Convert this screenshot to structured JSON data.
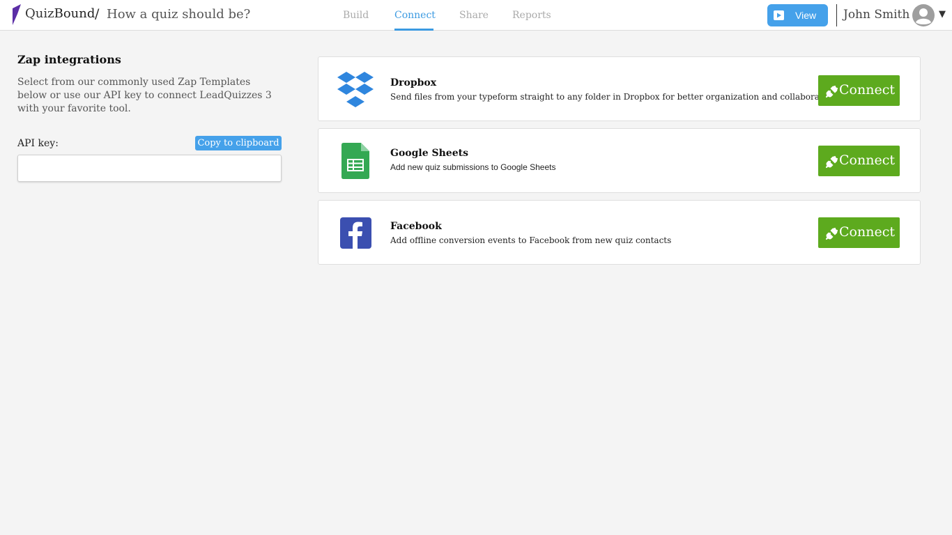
{
  "header": {
    "brand_part1": "Quiz",
    "brand_part2": "Bound",
    "separator": "/",
    "quiz_title": "How a quiz should be?",
    "tabs": [
      {
        "label": "Build",
        "active": false
      },
      {
        "label": "Connect",
        "active": true
      },
      {
        "label": "Share",
        "active": false
      },
      {
        "label": "Reports",
        "active": false
      }
    ],
    "view_button": "View",
    "username": "John Smith",
    "caret": "▼"
  },
  "left": {
    "title": "Zap integrations",
    "description": "Select from our commonly used Zap Templates below or use our API key to connect LeadQuizzes 3 with your favorite tool.",
    "api_label": "API key:",
    "copy_button": "Copy to clipboard",
    "api_value": ""
  },
  "integrations": [
    {
      "name": "Dropbox",
      "description": "Send files from your typeform straight to any folder in Dropbox for better organization and collaboration",
      "button": "Connect",
      "icon": "dropbox-icon"
    },
    {
      "name": "Google Sheets",
      "description": "Add new quiz submissions to Google Sheets",
      "button": "Connect",
      "icon": "google-sheets-icon"
    },
    {
      "name": "Facebook",
      "description": "Add offline conversion events to Facebook from new quiz contacts",
      "button": "Connect",
      "icon": "facebook-icon"
    }
  ],
  "colors": {
    "accent": "#45a1ea",
    "active_tab": "#3b9ae1",
    "connect": "#5daa1e",
    "background": "#f4f4f4",
    "logo": "#5b2ea6"
  }
}
